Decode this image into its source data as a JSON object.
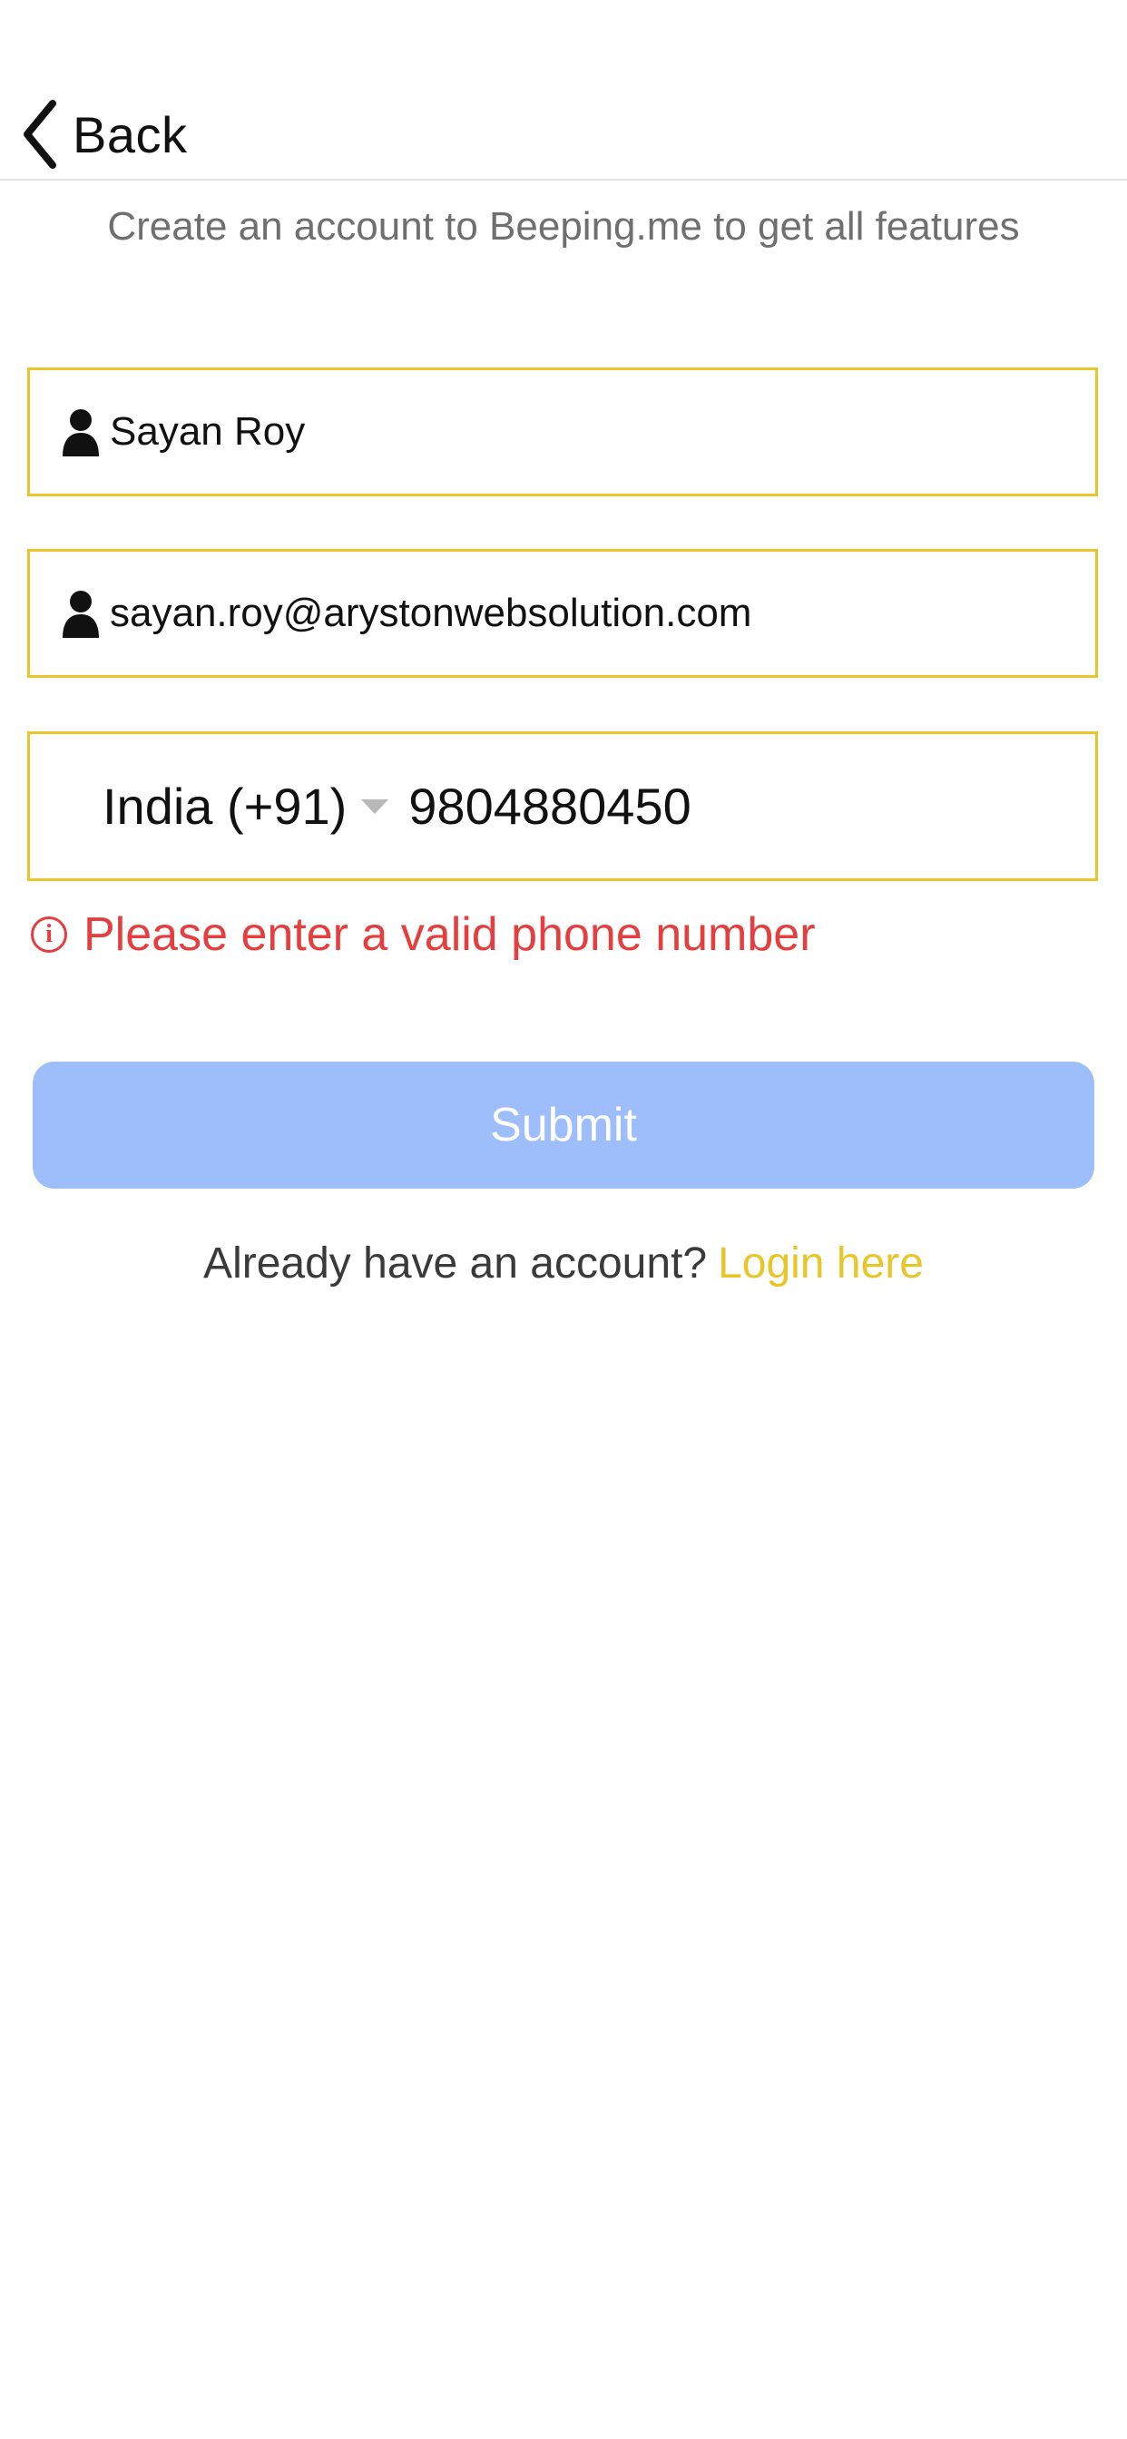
{
  "nav": {
    "back_label": "Back"
  },
  "subtitle": "Create an account to Beeping.me to get all features",
  "form": {
    "name_value": "Sayan Roy",
    "email_value": "sayan.roy@arystonwebsolution.com",
    "country_label": "India (+91)",
    "phone_value": "9804880450",
    "error_message": "Please enter a valid phone number",
    "submit_label": "Submit"
  },
  "footer": {
    "prompt": "Already have an account?",
    "login_link": "Login here"
  },
  "colors": {
    "field_border": "#e8c62a",
    "error": "#e53e3e",
    "submit_bg": "#9dbefb",
    "link": "#e8c62a",
    "subtitle": "#6f6f6f"
  },
  "icons": {
    "back": "chevron-left-icon",
    "person": "person-icon",
    "dropdown": "caret-down-icon",
    "error": "info-circle-icon"
  }
}
